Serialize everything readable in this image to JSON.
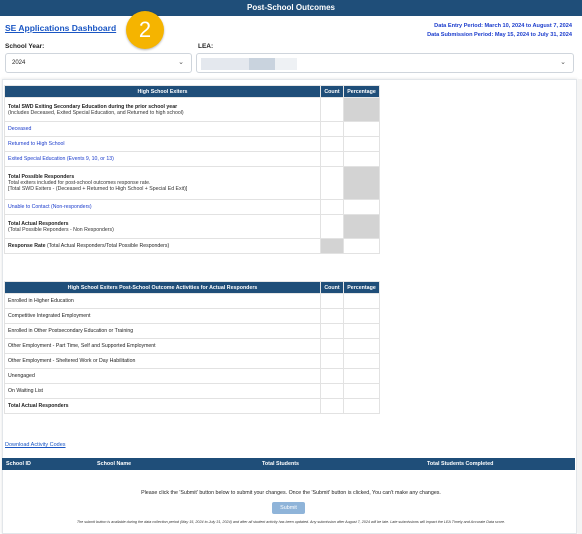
{
  "header": {
    "title": "Post-School Outcomes",
    "dashboard_link": "SE Applications Dashboard",
    "step_number": "2",
    "data_entry_period": "Data Entry Period: March 10, 2024 to August 7, 2024",
    "data_submission_period": "Data Submission Period: May 15, 2024 to July 31, 2024"
  },
  "filters": {
    "school_year_label": "School Year:",
    "school_year_value": "2024",
    "lea_label": "LEA:",
    "lea_value": ""
  },
  "exiters_table": {
    "title": "High School Exiters",
    "col_count": "Count",
    "col_percentage": "Percentage",
    "rows": [
      {
        "main": "Total SWD Exiting Secondary Education during the prior school year",
        "sub": "(Includes Deceased, Exited Special Education, and Returned to high school)"
      },
      {
        "main": "Deceased"
      },
      {
        "main": "Returned to High School"
      },
      {
        "main": "Exited Special Education (Events 9, 10, or 13)"
      },
      {
        "main": "Total Possible Responders",
        "sub": "Total exiters included for post-school outcomes response rate.",
        "sub2": "[Total SWD Exiters - (Deceased + Returned to High School + Special Ed Exit)]"
      },
      {
        "main": "Unable to Contact (Non-responders)"
      },
      {
        "main": "Total Actual Responders",
        "sub": "(Total Possible Reponders - Non Responders)"
      },
      {
        "main": "Response Rate",
        "sub": "(Total Actual Responders/Total Possible Responders)"
      }
    ]
  },
  "activities_table": {
    "title": "High School Exiters Post-School Outcome Activities for Actual Responders",
    "col_count": "Count",
    "col_percentage": "Percentage",
    "rows": [
      "Enrolled in Higher Education",
      "Competitive Integrated Employment",
      "Enrolled in Other Postsecondary Education or Training",
      "Other Employment - Part Time, Self and Supported Employment",
      "Other Employment - Sheltered Work or Day Habilitation",
      "Unengaged",
      "On Waiting List",
      "Total Actual Responders"
    ]
  },
  "download_link": "Download Activity Codes",
  "bottom_table": {
    "col_school_id": "School ID",
    "col_school_name": "School Name",
    "col_total_students": "Total Students",
    "col_total_completed": "Total Students Completed"
  },
  "instructions": "Please click the 'Submit' button below to submit your changes. Once the 'Submit' button is clicked, You can't make any changes.",
  "submit_label": "Submit",
  "footnote": "The submit button is available during the data collection period (May 15, 2024 to July 31, 2024) and after all student activity has been updated. Any submission after August 7, 2024 will be late. Late submissions will impact the LEA Timely and Accurate Data score.",
  "colors": {
    "header_blue": "#1f4e79",
    "link_blue": "#1a3bcc",
    "badge_orange": "#f5b400",
    "shaded_cell": "#d3d3d3",
    "submit_button": "#8fb4d9"
  }
}
